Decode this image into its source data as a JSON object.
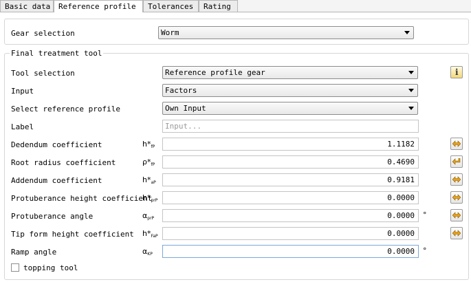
{
  "tabs": [
    {
      "label": "Basic data"
    },
    {
      "label": "Reference profile"
    },
    {
      "label": "Tolerances"
    },
    {
      "label": "Rating"
    }
  ],
  "gear_selection": {
    "label": "Gear selection",
    "value": "Worm"
  },
  "final_treatment": {
    "legend": "Final treatment tool",
    "tool_selection": {
      "label": "Tool selection",
      "value": "Reference profile gear"
    },
    "input": {
      "label": "Input",
      "value": "Factors"
    },
    "select_reference_profile": {
      "label": "Select reference profile",
      "value": "Own Input"
    },
    "label_field": {
      "label": "Label",
      "placeholder": "Input..."
    },
    "rows": [
      {
        "label": "Dedendum coefficient",
        "sym": "h*",
        "sub": "fP",
        "value": "1.1182"
      },
      {
        "label": "Root radius coefficient",
        "sym": "ρ*",
        "sub": "fP",
        "value": "0.4690"
      },
      {
        "label": "Addendum coefficient",
        "sym": "h*",
        "sub": "aP",
        "value": "0.9181"
      },
      {
        "label": "Protuberance height coefficient",
        "sym": "h*",
        "sub": "prP",
        "value": "0.0000"
      },
      {
        "label": "Protuberance angle",
        "sym": "α",
        "sub": "prP",
        "value": "0.0000",
        "unit": "°"
      },
      {
        "label": "Tip form height coefficient",
        "sym": "h*",
        "sub": "FaP",
        "value": "0.0000"
      },
      {
        "label": "Ramp angle",
        "sym": "α",
        "sub": "KP",
        "value": "0.0000",
        "unit": "°"
      }
    ],
    "topping_tool": {
      "label": "topping tool",
      "checked": false
    }
  },
  "info_icon": "i",
  "colors": {
    "arrow_orange": "#e8a21a",
    "arrow_dark": "#8a5a00"
  }
}
